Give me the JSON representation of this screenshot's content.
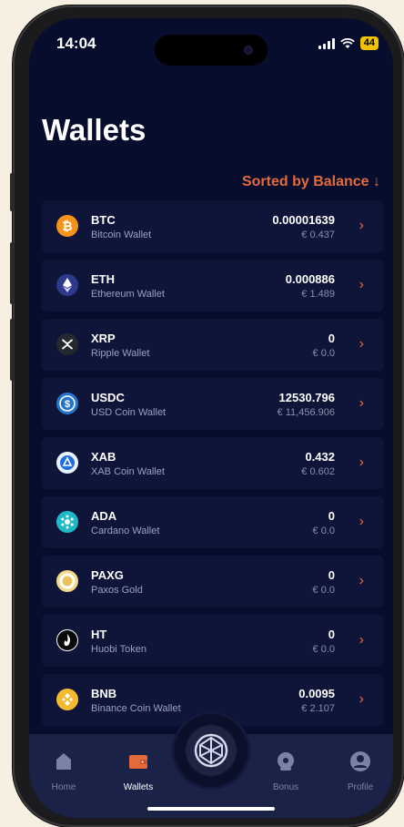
{
  "status_bar": {
    "time": "14:04",
    "battery": "44"
  },
  "page": {
    "title": "Wallets",
    "sort_label": "Sorted by Balance ↓"
  },
  "wallets": [
    {
      "symbol": "BTC",
      "name": "Bitcoin Wallet",
      "balance": "0.00001639",
      "fiat": "€ 0.437",
      "icon": "bitcoin-icon"
    },
    {
      "symbol": "ETH",
      "name": "Ethereum Wallet",
      "balance": "0.000886",
      "fiat": "€ 1.489",
      "icon": "ethereum-icon"
    },
    {
      "symbol": "XRP",
      "name": "Ripple Wallet",
      "balance": "0",
      "fiat": "€ 0.0",
      "icon": "xrp-icon"
    },
    {
      "symbol": "USDC",
      "name": "USD Coin Wallet",
      "balance": "12530.796",
      "fiat": "€ 11,456.906",
      "icon": "usdc-icon"
    },
    {
      "symbol": "XAB",
      "name": "XAB Coin Wallet",
      "balance": "0.432",
      "fiat": "€ 0.602",
      "icon": "xab-icon"
    },
    {
      "symbol": "ADA",
      "name": "Cardano Wallet",
      "balance": "0",
      "fiat": "€ 0.0",
      "icon": "cardano-icon"
    },
    {
      "symbol": "PAXG",
      "name": "Paxos Gold",
      "balance": "0",
      "fiat": "€ 0.0",
      "icon": "paxg-icon"
    },
    {
      "symbol": "HT",
      "name": "Huobi Token",
      "balance": "0",
      "fiat": "€ 0.0",
      "icon": "huobi-icon"
    },
    {
      "symbol": "BNB",
      "name": "Binance Coin Wallet",
      "balance": "0.0095",
      "fiat": "€ 2.107",
      "icon": "bnb-icon"
    }
  ],
  "tabs": {
    "home": "Home",
    "wallets": "Wallets",
    "bonus": "Bonus",
    "profile": "Profile"
  },
  "colors": {
    "accent": "#e46a3c",
    "background": "#070d2d",
    "card": "#0f1538",
    "tabbar": "#1a2247"
  }
}
